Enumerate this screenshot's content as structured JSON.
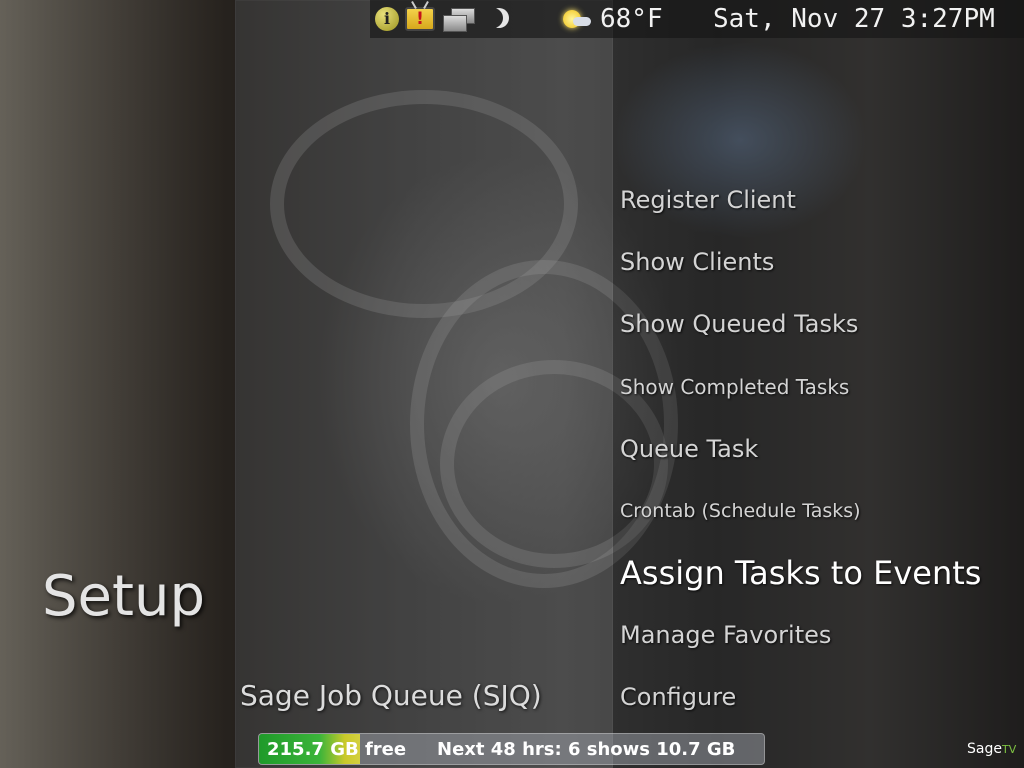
{
  "status_bar": {
    "icons": [
      "info-icon",
      "tv-alert-icon",
      "windows-icon",
      "moon-icon",
      "partly-sunny-icon"
    ],
    "temperature": "68°F",
    "datetime": "Sat, Nov 27 3:27PM"
  },
  "menu": {
    "items": [
      {
        "label": "Register Client",
        "selected": false
      },
      {
        "label": "Show Clients",
        "selected": false
      },
      {
        "label": "Show Queued Tasks",
        "selected": false
      },
      {
        "label": "Show Completed Tasks",
        "selected": false
      },
      {
        "label": "Queue Task",
        "selected": false
      },
      {
        "label": "Crontab (Schedule Tasks)",
        "selected": false
      },
      {
        "label": "Assign Tasks to Events",
        "selected": true
      },
      {
        "label": "Manage Favorites",
        "selected": false
      },
      {
        "label": "Configure",
        "selected": false
      }
    ]
  },
  "section_title": "Setup",
  "subtitle": "Sage Job Queue (SJQ)",
  "disk_bar": {
    "free_text": "215.7 GB free",
    "next_shows_text": "Next 48 hrs: 6 shows 10.7 GB"
  },
  "logo": {
    "text": "Sage",
    "suffix": "TV"
  },
  "colors": {
    "disk_green": "#2aa632",
    "disk_yellow": "#cfcb35",
    "text": "#d4d4d4",
    "selected_text": "#ffffff"
  }
}
